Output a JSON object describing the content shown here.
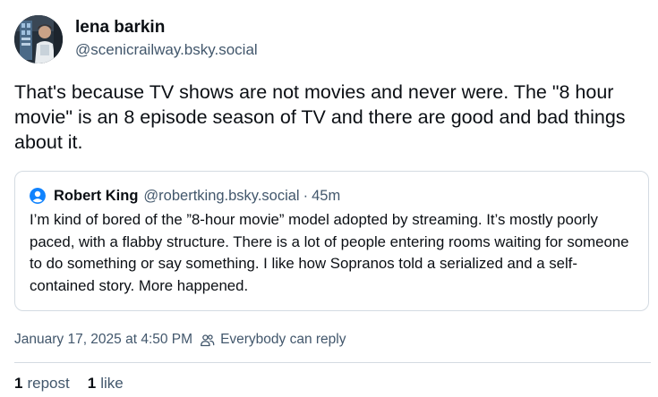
{
  "post": {
    "author": {
      "display_name": "lena barkin",
      "handle": "@scenicrailway.bsky.social",
      "avatar_icon": "profile-photo"
    },
    "text": "That's because TV shows are not movies and never were. The \"8 hour movie\" is an 8 episode season of TV and there are good and bad things about it.",
    "quote": {
      "author_name": "Robert King",
      "author_handle": "@robertking.bsky.social",
      "separator": "·",
      "time": "45m",
      "avatar_icon": "default-avatar-icon",
      "text": "I’m kind of bored of the ”8-hour movie” model adopted by streaming. It’s mostly poorly paced, with a flabby structure. There is a lot of people entering rooms waiting for someone to do something or say something. I like how Sopranos told a serialized and a self-contained story. More happened."
    },
    "meta": {
      "timestamp": "January 17, 2025 at 4:50 PM",
      "reply_setting": "Everybody can reply",
      "reply_icon": "people-icon"
    },
    "stats": {
      "repost_count": "1",
      "repost_label": "repost",
      "like_count": "1",
      "like_label": "like"
    }
  },
  "colors": {
    "text_primary": "#0b0f14",
    "text_secondary": "#42576c",
    "border": "#d4dbe2",
    "accent": "#1083fe"
  }
}
